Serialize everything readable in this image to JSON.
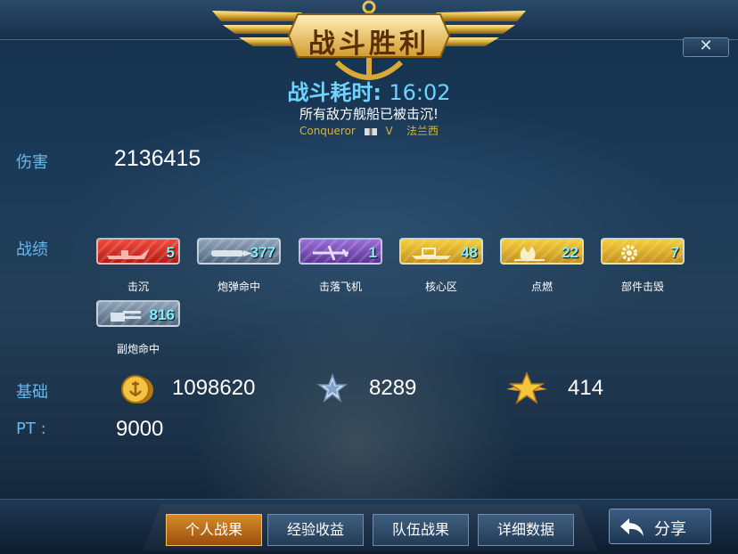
{
  "header": {
    "banner_title": "战斗胜利",
    "close_glyph": "✕",
    "duration_label": "战斗耗时:",
    "duration_value": "16:02",
    "result_text": "所有敌方舰船已被击沉!",
    "ship_name": "Conqueror",
    "tier": "V",
    "nation": "法兰西"
  },
  "damage": {
    "label": "伤害",
    "value": "2136415"
  },
  "record": {
    "label": "战绩",
    "badges": [
      {
        "label": "击沉",
        "count": "5",
        "color": "#d8281e",
        "icon": "sunk-ship-icon"
      },
      {
        "label": "炮弹命中",
        "count": "377",
        "color": "#6f8aa6",
        "icon": "shell-hit-icon"
      },
      {
        "label": "击落飞机",
        "count": "1",
        "color": "#7a4cc0",
        "icon": "plane-shot-down-icon"
      },
      {
        "label": "核心区",
        "count": "48",
        "color": "#e0a92a",
        "icon": "citadel-icon"
      },
      {
        "label": "点燃",
        "count": "22",
        "color": "#e0a92a",
        "icon": "fire-icon"
      },
      {
        "label": "部件击毁",
        "count": "7",
        "color": "#e0a92a",
        "icon": "module-destroyed-icon"
      },
      {
        "label": "副炮命中",
        "count": "816",
        "color": "#6f8aa6",
        "icon": "secondary-battery-icon"
      }
    ]
  },
  "basic": {
    "label": "基础",
    "coins": "1098620",
    "xp": "8289",
    "free_xp": "414"
  },
  "pt": {
    "label": "PT :",
    "value": "9000"
  },
  "tabs": [
    "个人战果",
    "经验收益",
    "队伍战果",
    "详细数据"
  ],
  "share_label": "分享",
  "colors": {
    "accent": "#68b8ee",
    "gold": "#d9b23a",
    "active_tab": "#d78b2a"
  }
}
